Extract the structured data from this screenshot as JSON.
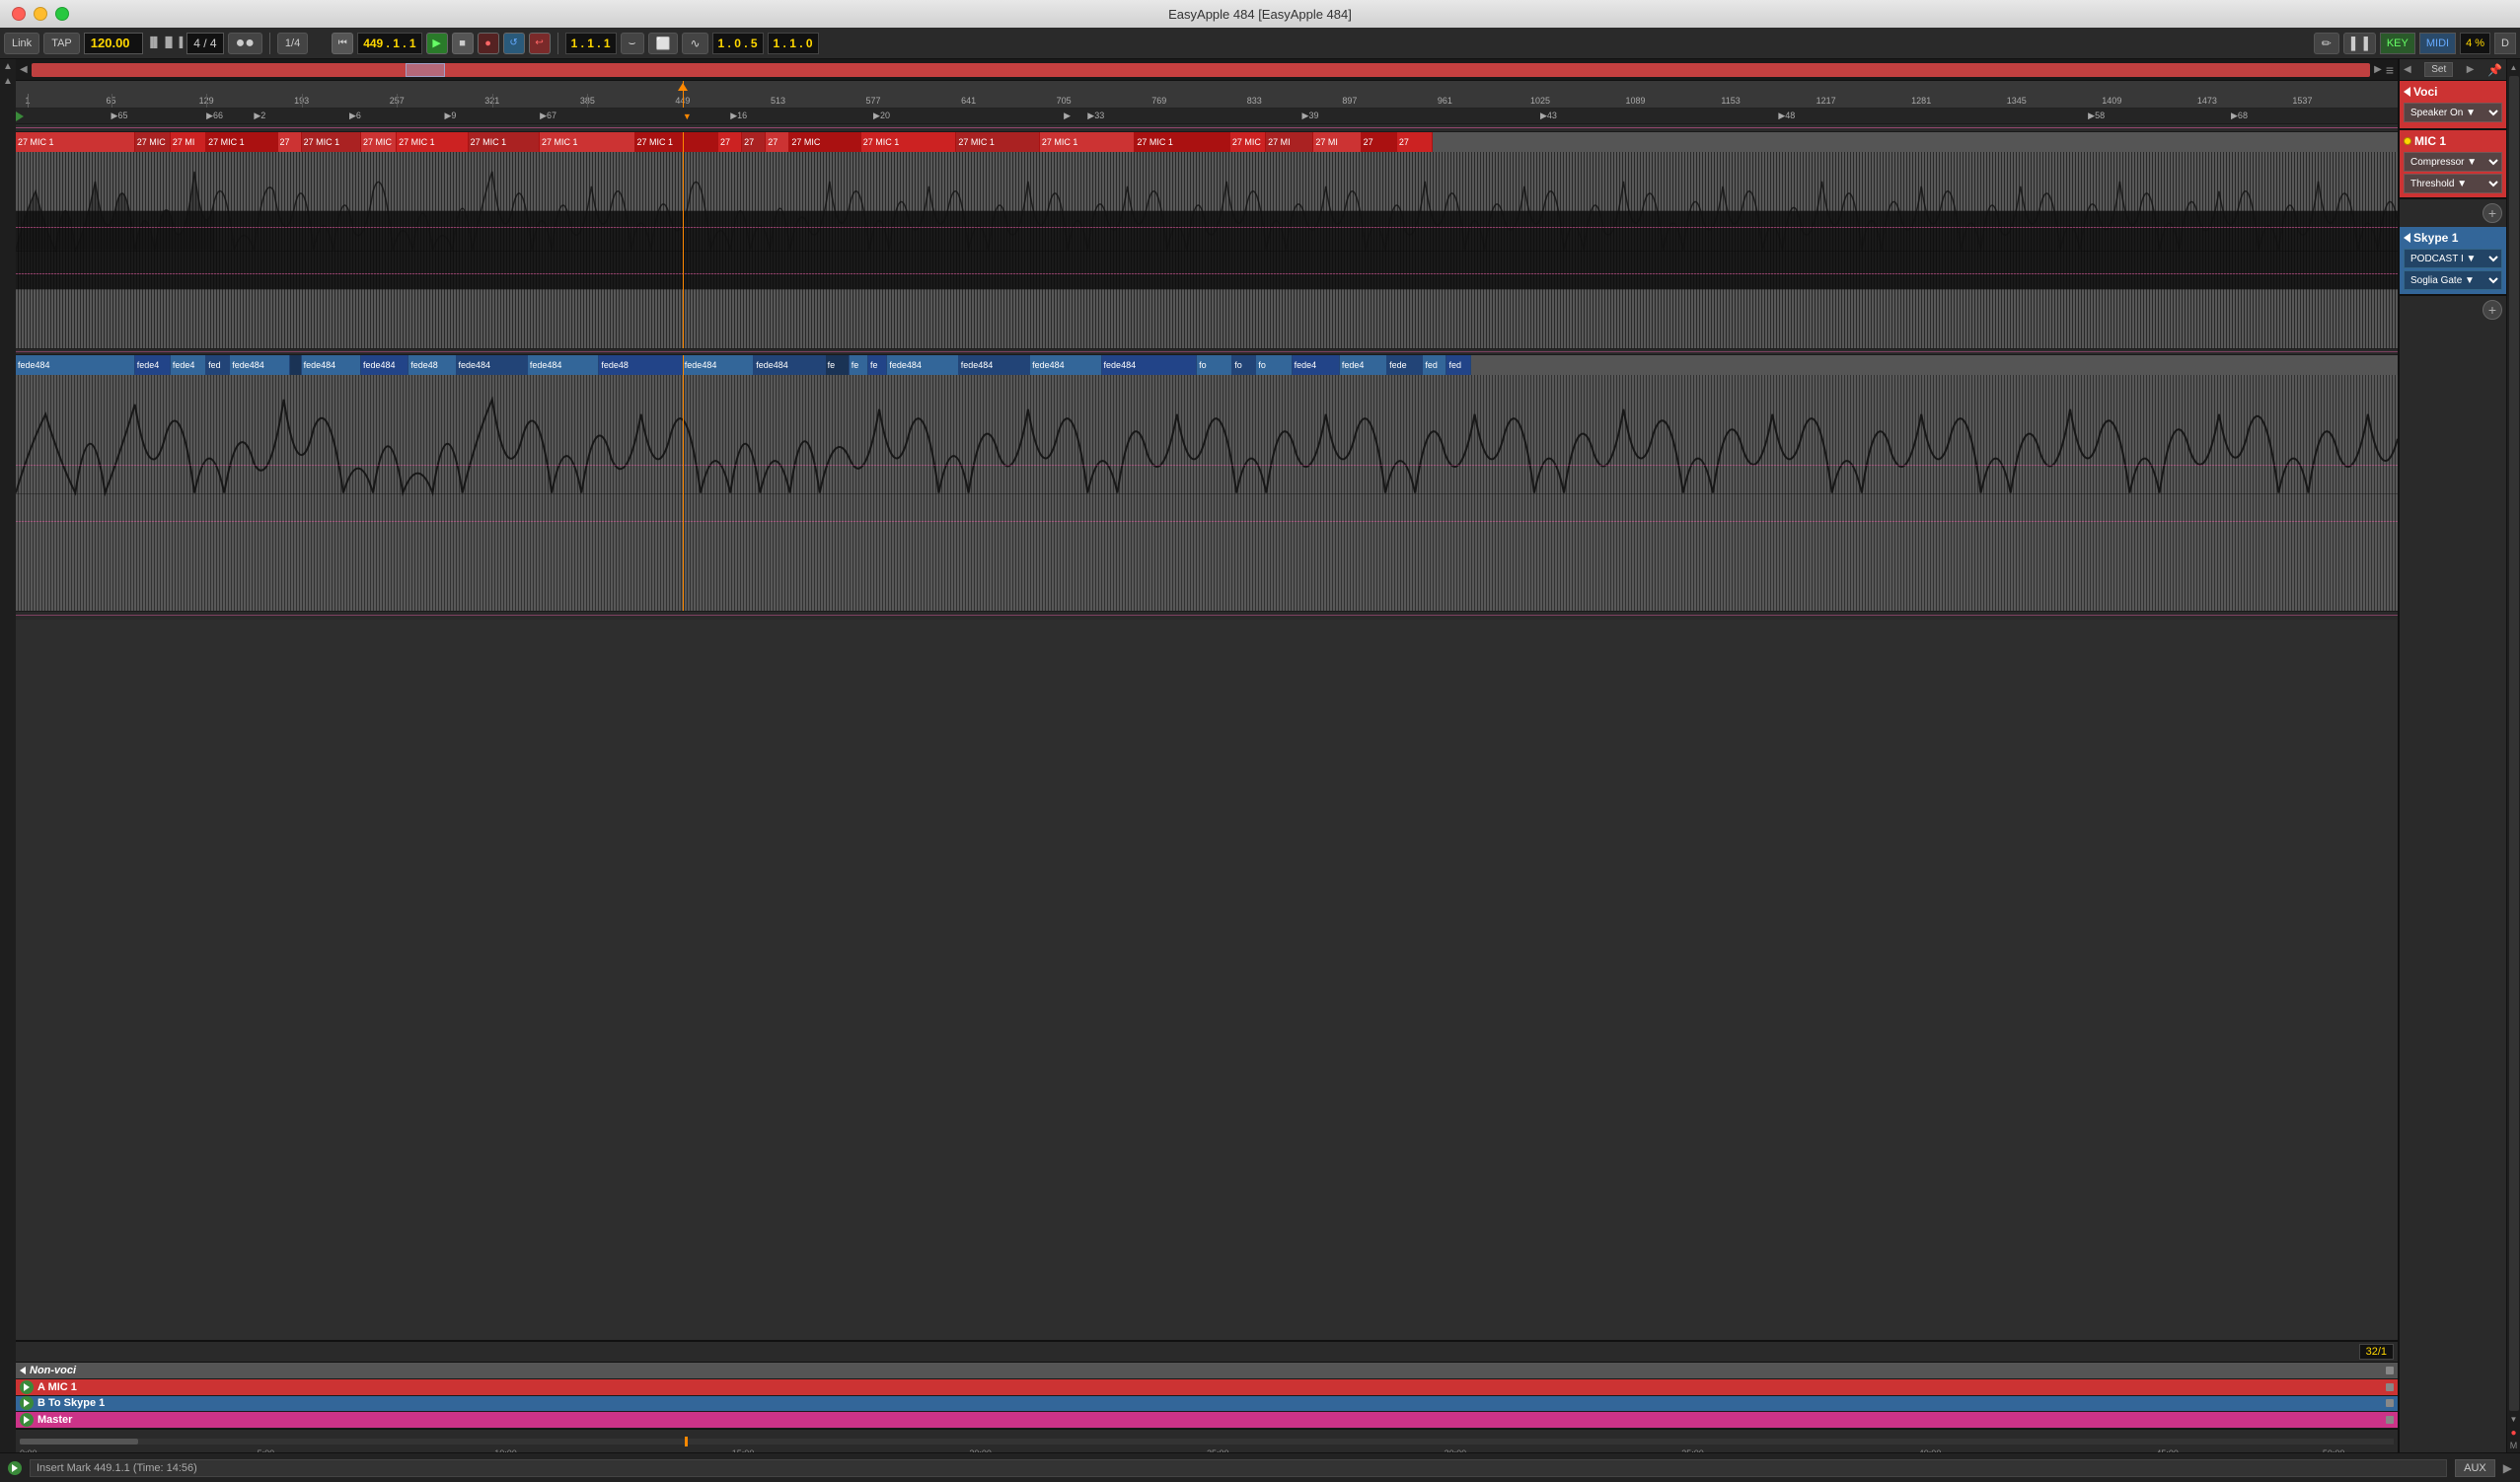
{
  "window": {
    "title": "EasyApple 484  [EasyApple 484]"
  },
  "transport": {
    "link_label": "Link",
    "tap_label": "TAP",
    "tempo": "120.00",
    "time_sig": "4 / 4",
    "loop_end": "1/4",
    "position": "449 . 1 . 1",
    "counter": "1 . 1 . 1",
    "zoom": "4 %",
    "key_label": "KEY",
    "midi_label": "MIDI",
    "d_label": "D"
  },
  "ruler": {
    "marks": [
      "1",
      "65",
      "129",
      "193",
      "257",
      "321",
      "385",
      "449",
      "513",
      "577",
      "641",
      "705",
      "769",
      "833",
      "897",
      "961",
      "1025",
      "1089",
      "1153",
      "1217",
      "1281",
      "1345",
      "1409",
      "1473",
      "1537"
    ]
  },
  "markers": {
    "labels": [
      "65",
      "66",
      "2",
      "6",
      "9",
      "67",
      "16",
      "20",
      "33",
      "39",
      "43",
      "48",
      "58",
      "68"
    ]
  },
  "tracks": {
    "voci": {
      "name": "Voci",
      "type": "folder",
      "mic1": {
        "name": "MIC 1",
        "compressor": "Compressor",
        "threshold": "Threshold",
        "clips": [
          "27 MIC 1",
          "27 MIC",
          "27 MIC",
          "27 MIC 1",
          "27 MIC",
          "27 MIC 1",
          "27 MIC 1",
          "27 MIC 1",
          "27 MIC 1",
          "27 MIC 1",
          "27 MIC 1",
          "27 MIC",
          "27 MIC",
          "27 MIC 1",
          "27 MIC 1",
          "27 MIC 1",
          "27 MIC",
          "27 MI",
          "27 MI",
          "27",
          "27"
        ],
        "speaker_on": "Speaker On"
      }
    },
    "skype1": {
      "name": "Skype 1",
      "type": "folder",
      "podcast": "PODCAST I",
      "soglia_gate": "Soglia Gate",
      "clips": [
        "fede484",
        "fede4",
        "fede4",
        "fed",
        "fede484",
        "fede484",
        "fede484",
        "fede48",
        "fede484",
        "fede484",
        "fede48",
        "fede484",
        "fede484",
        "fede484",
        "fede",
        "fede",
        "fede484",
        "fede484",
        "fede4",
        "fede",
        "fed",
        "fed"
      ]
    },
    "bottom": {
      "non_voci": "Non-voci",
      "a_mic1": "A MIC 1",
      "b_skype1": "B To Skype 1",
      "master": "Master"
    }
  },
  "bottom_bar": {
    "status": "Insert Mark 449.1.1 (Time: 14:56)",
    "time_display": "32/1",
    "aux_label": "AUX"
  },
  "inspector": {
    "voci_section": {
      "title": "Voci",
      "speaker_on": "Speaker On ▼"
    },
    "mic1_section": {
      "title": "MIC 1",
      "compressor": "Compressor ▼",
      "threshold": "Threshold ▼"
    },
    "skype1_section": {
      "title": "Skype 1",
      "podcast": "PODCAST I ▼",
      "soglia_gate": "Soglia Gate ▼"
    }
  }
}
